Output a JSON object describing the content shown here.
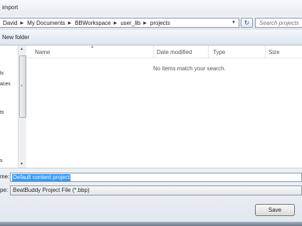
{
  "window": {
    "title": "import"
  },
  "address_bar": {
    "crumbs": [
      "David",
      "My Documents",
      "BBWorkspace",
      "user_lib",
      "projects"
    ],
    "dropdown_icon": "chevron-down-icon"
  },
  "refresh_icon": "refresh-icon",
  "search": {
    "placeholder": "Search projects"
  },
  "toolbar": {
    "new_folder_label": "New folder"
  },
  "nav_pane": {
    "items": [
      "ls",
      "aces",
      "ts",
      "s"
    ]
  },
  "file_list": {
    "columns": [
      "Name",
      "Date modified",
      "Type",
      "Size"
    ],
    "empty_message": "No items match your search."
  },
  "form": {
    "name_label": "me:",
    "name_value": "Default content project",
    "type_label": "pe:",
    "type_value": "BeatBuddy Project File (*.bbp)"
  },
  "buttons": {
    "save_label": "Save"
  },
  "colors": {
    "selection": "#3399ff"
  }
}
